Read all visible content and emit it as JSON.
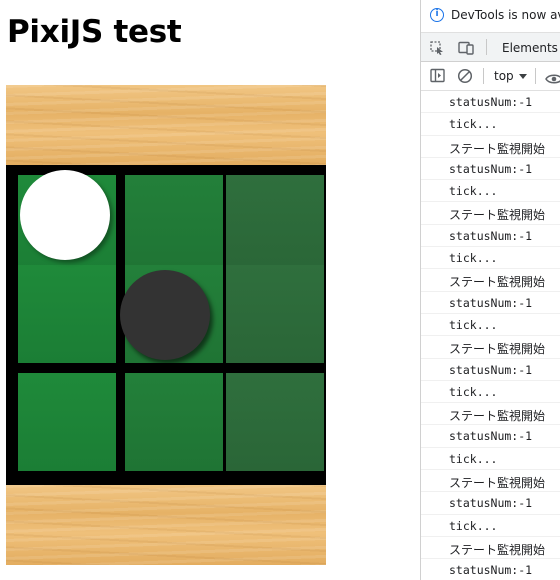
{
  "page": {
    "title": "PixiJS test"
  },
  "game": {
    "board_size": [
      3,
      3
    ],
    "stones": [
      {
        "row": 0,
        "col": 0,
        "color": "white"
      },
      {
        "row": 1,
        "col": 1,
        "color": "black"
      }
    ],
    "colors": {
      "cell_green": "#1f8a3a",
      "grid_line": "#000000",
      "white_stone": "#ffffff",
      "black_stone": "#333333",
      "wood": "#e7b66e"
    }
  },
  "devtools": {
    "notice_text": "DevTools is now avai",
    "tabs": {
      "elements_label": "Elements"
    },
    "toolbar": {
      "context_label": "top"
    },
    "console_lines": [
      "statusNum:-1",
      "tick...",
      "ステート監視開始",
      "statusNum:-1",
      "tick...",
      "ステート監視開始",
      "statusNum:-1",
      "tick...",
      "ステート監視開始",
      "statusNum:-1",
      "tick...",
      "ステート監視開始",
      "statusNum:-1",
      "tick...",
      "ステート監視開始",
      "statusNum:-1",
      "tick...",
      "ステート監視開始",
      "statusNum:-1",
      "tick...",
      "ステート監視開始",
      "statusNum:-1"
    ]
  }
}
